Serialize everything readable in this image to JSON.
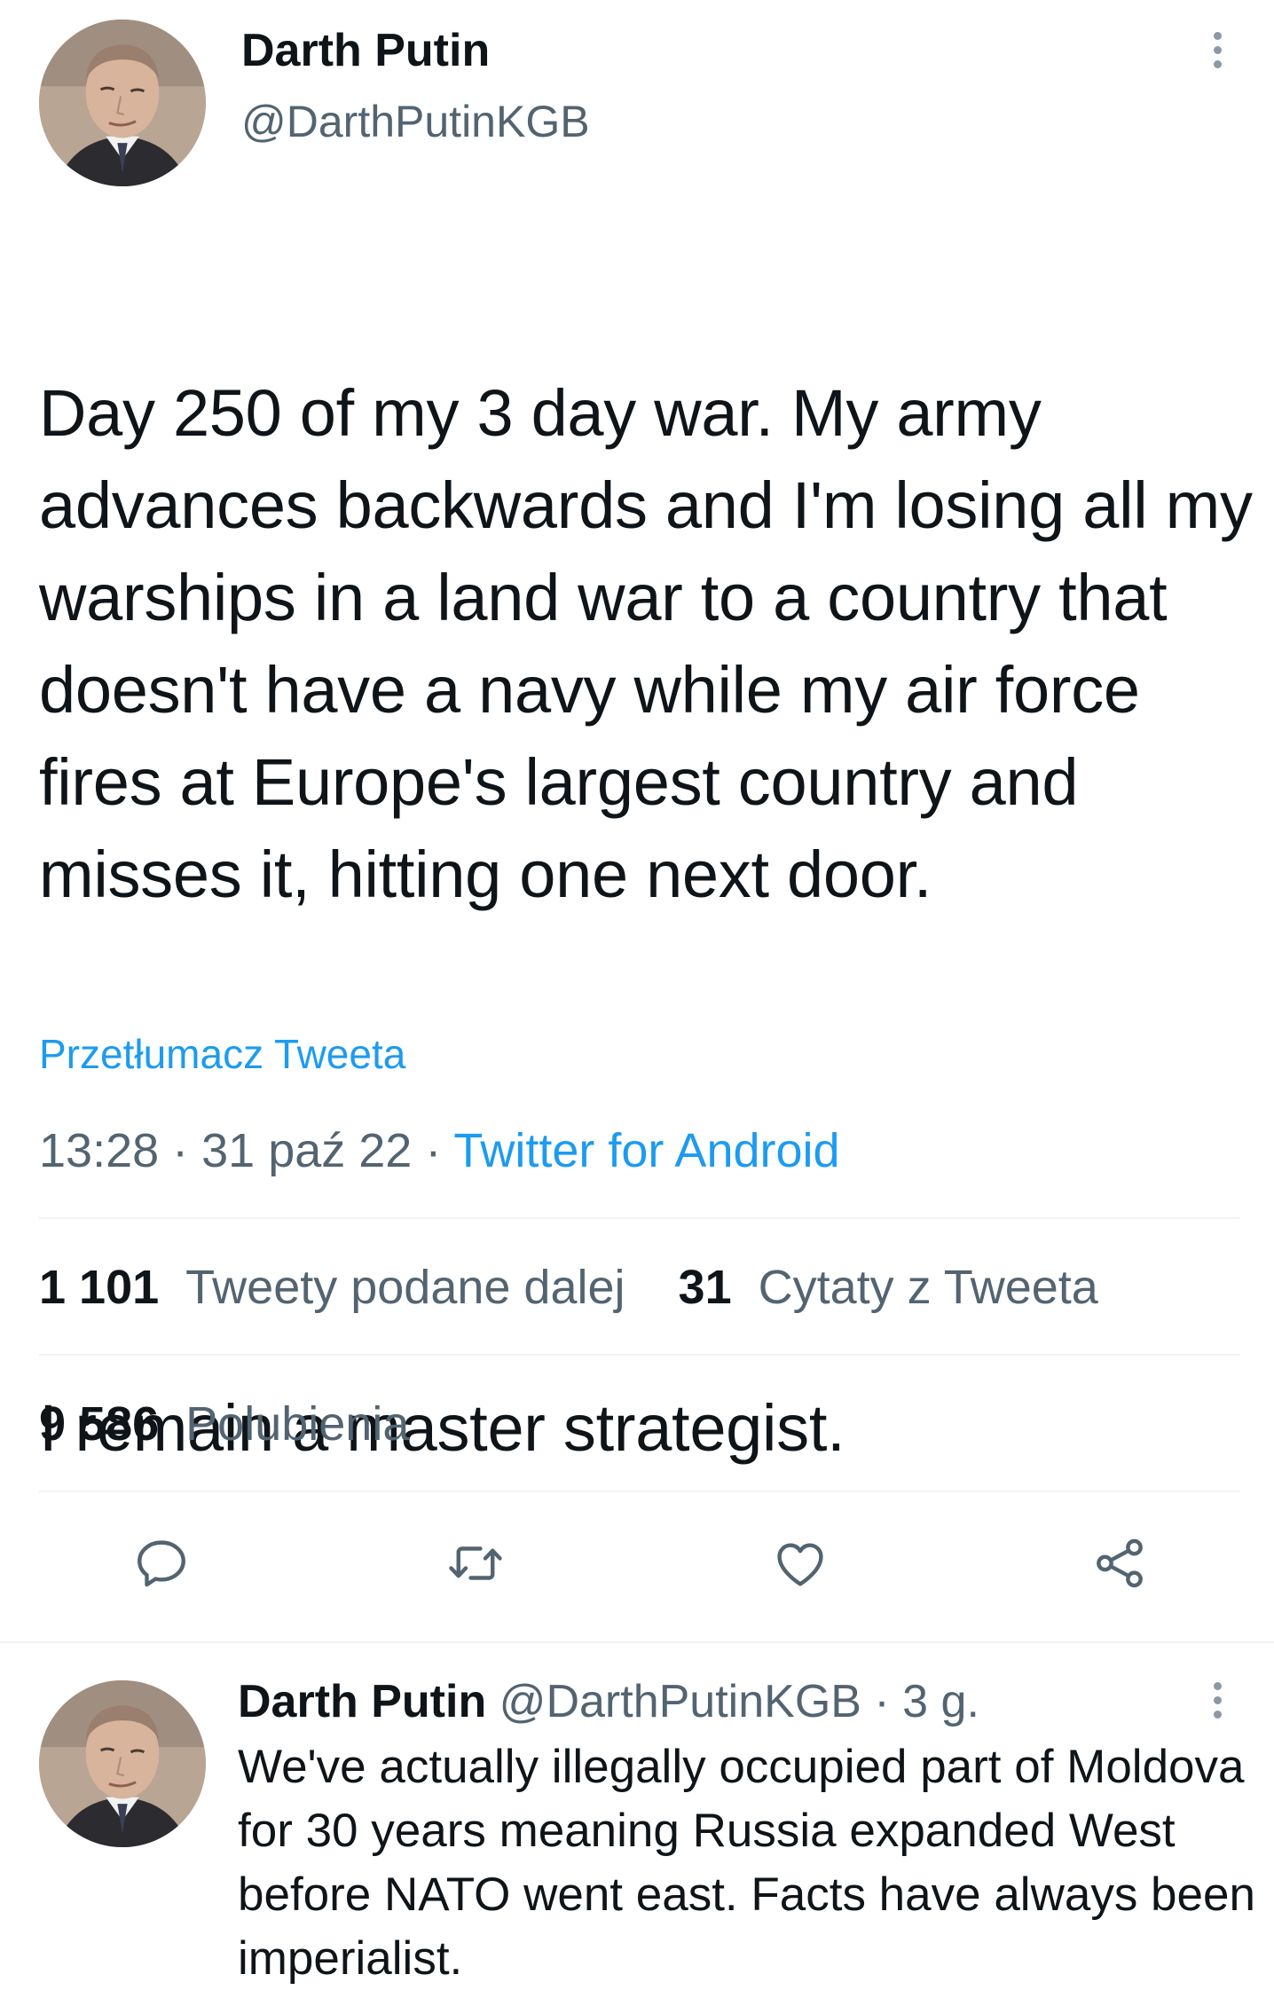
{
  "main_tweet": {
    "author_name": "Darth Putin",
    "author_handle": "@DarthPutinKGB",
    "text_paragraph_1": "Day 250 of my 3 day war. My army advances backwards and I'm losing all my warships in a land war to a country that doesn't have a navy while my air force fires at Europe's largest country and misses it, hitting one next door.",
    "text_paragraph_2": "I remain a master strategist.",
    "translate_label": "Przetłumacz Tweeta",
    "time": "13:28",
    "date": "31 paź 22",
    "separator": " · ",
    "source": "Twitter for Android",
    "retweets_count": "1 101",
    "retweets_label": "Tweety podane dalej",
    "quotes_count": "31",
    "quotes_label": "Cytaty z Tweeta",
    "likes_count": "9 586",
    "likes_label": "Polubienia"
  },
  "actions": {
    "reply_icon": "reply-icon",
    "retweet_icon": "retweet-icon",
    "like_icon": "heart-icon",
    "share_icon": "share-icon"
  },
  "reply_tweet": {
    "author_name": "Darth Putin",
    "author_handle": "@DarthPutinKGB",
    "age": "3 g.",
    "separator": " · ",
    "text": "We've actually illegally occupied part of Moldova for 30 years meaning Russia expanded West before NATO went east. Facts have always been imperialist."
  },
  "colors": {
    "accent": "#1d9bf0",
    "secondary_text": "#536471",
    "primary_text": "#0f1419",
    "divider": "#eff3f4"
  }
}
